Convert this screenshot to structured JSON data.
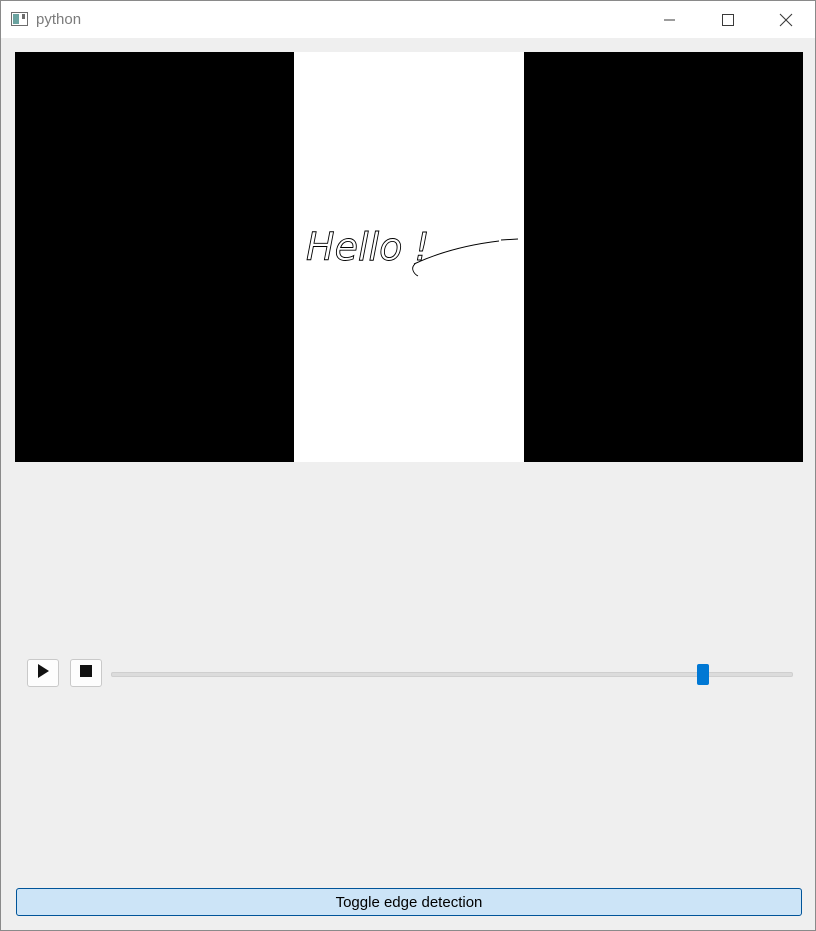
{
  "window": {
    "title": "python",
    "controls": [
      "minimize-icon",
      "maximize-icon",
      "close-icon"
    ]
  },
  "video": {
    "frame_text": "Hello !"
  },
  "player": {
    "play_icon": "play-icon",
    "stop_icon": "stop-icon",
    "position_fraction": 0.87,
    "accent_color": "#0078d4"
  },
  "actions": {
    "toggle_label": "Toggle edge detection"
  },
  "colors": {
    "button_bg": "#cce4f7",
    "button_border": "#005499",
    "window_bg": "#efefef"
  }
}
